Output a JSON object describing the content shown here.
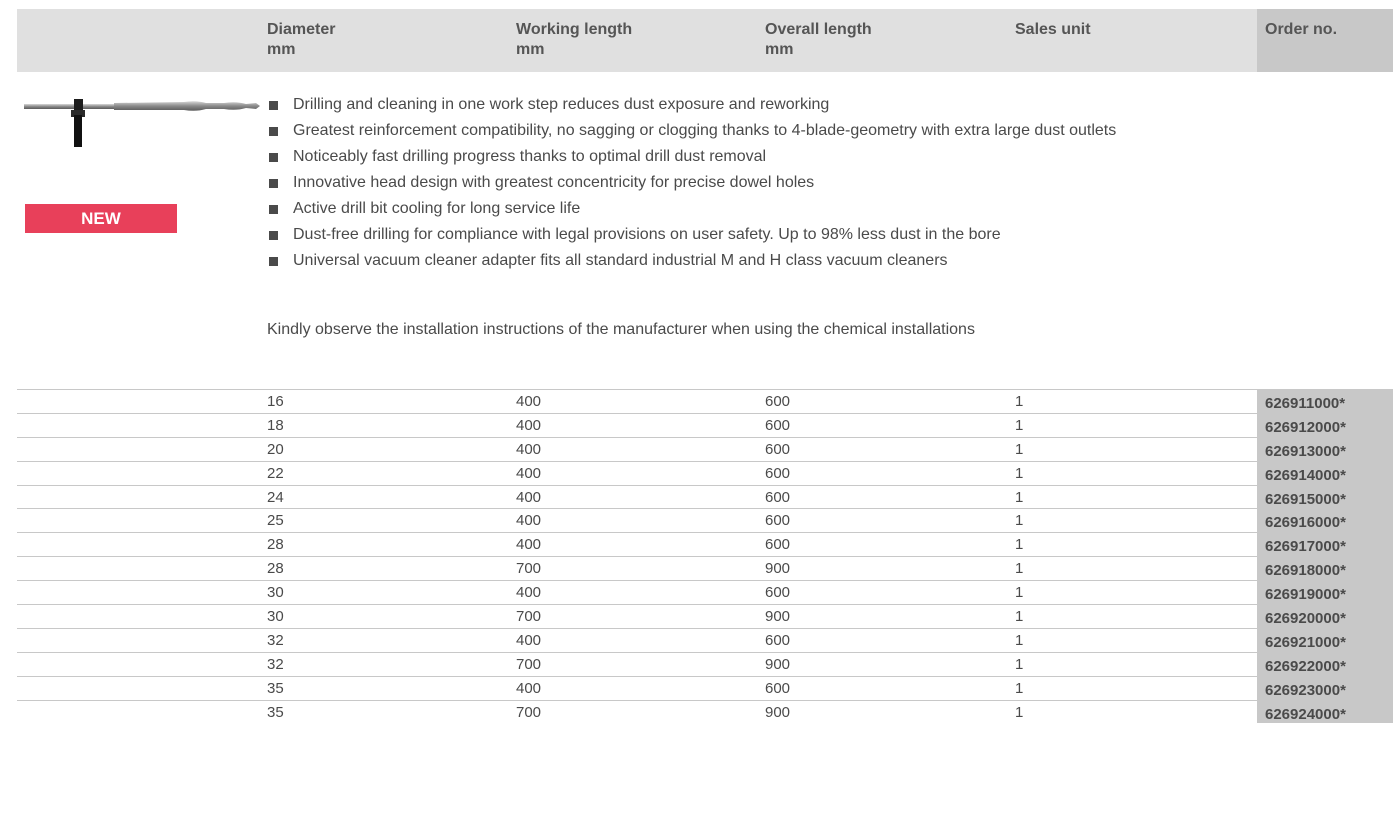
{
  "header": {
    "col_diameter": "Diameter",
    "col_diameter_unit": "mm",
    "col_working": "Working length",
    "col_working_unit": "mm",
    "col_overall": "Overall length",
    "col_overall_unit": "mm",
    "col_sales": "Sales unit",
    "col_order": "Order no."
  },
  "badge": "NEW",
  "features": [
    "Drilling and cleaning in one work step reduces dust exposure and reworking",
    "Greatest reinforcement compatibility, no sagging or clogging thanks to 4-blade-geometry with extra large dust outlets",
    "Noticeably fast drilling progress thanks to optimal drill dust removal",
    "Innovative head design with greatest concentricity for precise dowel holes",
    "Active drill bit cooling for long service life",
    "Dust-free drilling for compliance with legal provisions on user safety. Up to 98% less dust in the bore",
    "Universal vacuum cleaner adapter fits all standard industrial M and H class vacuum cleaners"
  ],
  "note": "Kindly observe the installation instructions of the manufacturer when using the chemical installations",
  "rows": [
    {
      "d": "16",
      "w": "400",
      "o": "600",
      "s": "1",
      "n": "626911000*"
    },
    {
      "d": "18",
      "w": "400",
      "o": "600",
      "s": "1",
      "n": "626912000*"
    },
    {
      "d": "20",
      "w": "400",
      "o": "600",
      "s": "1",
      "n": "626913000*"
    },
    {
      "d": "22",
      "w": "400",
      "o": "600",
      "s": "1",
      "n": "626914000*"
    },
    {
      "d": "24",
      "w": "400",
      "o": "600",
      "s": "1",
      "n": "626915000*"
    },
    {
      "d": "25",
      "w": "400",
      "o": "600",
      "s": "1",
      "n": "626916000*"
    },
    {
      "d": "28",
      "w": "400",
      "o": "600",
      "s": "1",
      "n": "626917000*"
    },
    {
      "d": "28",
      "w": "700",
      "o": "900",
      "s": "1",
      "n": "626918000*"
    },
    {
      "d": "30",
      "w": "400",
      "o": "600",
      "s": "1",
      "n": "626919000*"
    },
    {
      "d": "30",
      "w": "700",
      "o": "900",
      "s": "1",
      "n": "626920000*"
    },
    {
      "d": "32",
      "w": "400",
      "o": "600",
      "s": "1",
      "n": "626921000*"
    },
    {
      "d": "32",
      "w": "700",
      "o": "900",
      "s": "1",
      "n": "626922000*"
    },
    {
      "d": "35",
      "w": "400",
      "o": "600",
      "s": "1",
      "n": "626923000*"
    },
    {
      "d": "35",
      "w": "700",
      "o": "900",
      "s": "1",
      "n": "626924000*"
    }
  ]
}
